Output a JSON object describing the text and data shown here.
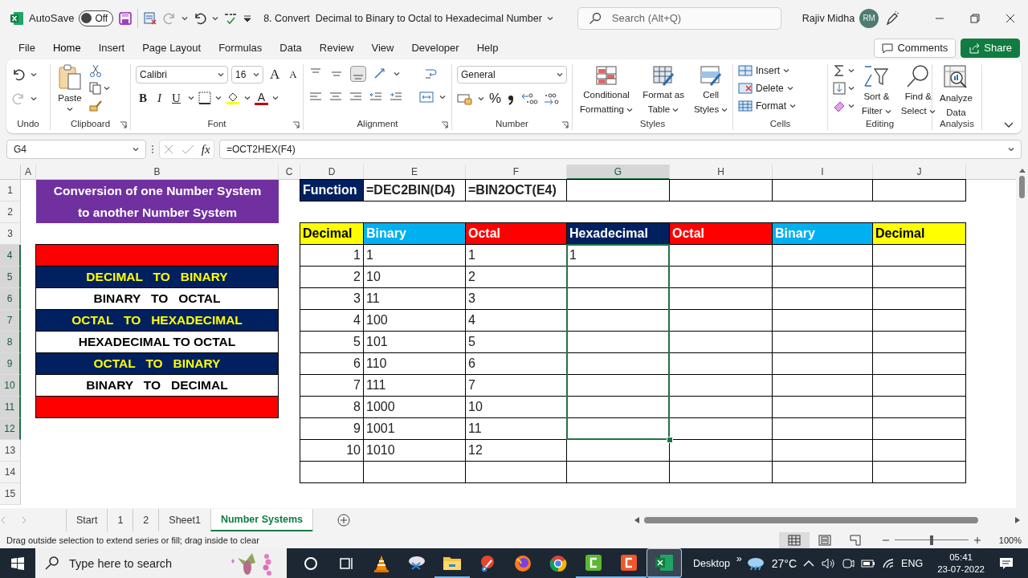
{
  "title_bar": {
    "autosave_label": "AutoSave",
    "autosave": {
      "label": "Off",
      "on": false
    },
    "title": "8. Convert  Decimal to Binary to Octal to Hexadecimal Number",
    "search": {
      "placeholder": "Search (Alt+Q)"
    },
    "user": "Rajiv Midha",
    "avatar": "RM"
  },
  "menu": {
    "tabs": [
      {
        "label": "File",
        "selected": false
      },
      {
        "label": "Home",
        "selected": true
      },
      {
        "label": "Insert",
        "selected": false
      },
      {
        "label": "Page Layout",
        "selected": false
      },
      {
        "label": "Formulas",
        "selected": false
      },
      {
        "label": "Data",
        "selected": false
      },
      {
        "label": "Review",
        "selected": false
      },
      {
        "label": "View",
        "selected": false
      },
      {
        "label": "Developer",
        "selected": false
      },
      {
        "label": "Help",
        "selected": false
      }
    ],
    "buttons": [
      {
        "label": "Comments",
        "kind": "outline"
      },
      {
        "label": "Share",
        "kind": "primary"
      }
    ]
  },
  "ribbon": {
    "groups": [
      {
        "kind": "undo",
        "label": "Undo"
      },
      {
        "kind": "clipboard",
        "label": "Clipboard",
        "paste": "Paste"
      },
      {
        "kind": "font",
        "label": "Font",
        "font": "Calibri",
        "size": "16",
        "size_buttons": [
          "A",
          "A"
        ],
        "style_buttons": [
          "B",
          "I",
          "U"
        ],
        "font_color": "A"
      },
      {
        "kind": "alignment",
        "label": "Alignment"
      },
      {
        "kind": "number",
        "label": "Number",
        "format": "General",
        "percent": "%"
      },
      {
        "kind": "styles",
        "label": "Styles",
        "buttons": [
          {
            "lines": [
              "Conditional",
              "Formatting"
            ]
          },
          {
            "lines": [
              "Format as",
              "Table"
            ]
          },
          {
            "lines": [
              "Cell",
              "Styles"
            ]
          }
        ]
      },
      {
        "kind": "cells",
        "label": "Cells",
        "buttons": [
          "Insert",
          "Delete",
          "Format"
        ]
      },
      {
        "kind": "editing",
        "label": "Editing",
        "buttons": [
          {
            "lines": [
              "Sort &",
              "Filter"
            ]
          },
          {
            "lines": [
              "Find &",
              "Select"
            ]
          }
        ]
      },
      {
        "kind": "analysis",
        "label": "Analysis",
        "buttons": [
          {
            "lines": [
              "Analyze",
              "Data"
            ]
          }
        ]
      }
    ]
  },
  "formula_bar": {
    "name_box": "G4",
    "function_label": "fx",
    "formula": "=OCT2HEX(F4)"
  },
  "grid": {
    "columns": [
      {
        "label": "A",
        "selected": false
      },
      {
        "label": "B",
        "selected": false
      },
      {
        "label": "C",
        "selected": false
      },
      {
        "label": "D",
        "selected": false
      },
      {
        "label": "E",
        "selected": false
      },
      {
        "label": "F",
        "selected": false
      },
      {
        "label": "G",
        "selected": true
      },
      {
        "label": "H",
        "selected": false
      },
      {
        "label": "I",
        "selected": false
      },
      {
        "label": "J",
        "selected": false
      }
    ],
    "rows": [
      {
        "number": "1",
        "selected": false,
        "cells": [
          {
            "kind": "empty"
          },
          {
            "kind": "title",
            "text": "Conversion of one Number System"
          },
          {
            "kind": "empty"
          },
          {
            "kind": "label",
            "text": "Function"
          },
          {
            "kind": "formula",
            "text": "=DEC2BIN(D4)"
          },
          {
            "kind": "formula",
            "text": "=BIN2OCT(E4)"
          },
          {
            "kind": "blank"
          },
          {
            "kind": "blank"
          },
          {
            "kind": "blank"
          },
          {
            "kind": "blank"
          }
        ]
      },
      {
        "number": "2",
        "selected": false,
        "cells": [
          {
            "kind": "empty"
          },
          {
            "kind": "title",
            "text": "to another Number System"
          },
          {
            "kind": "empty"
          },
          {
            "kind": "empty"
          },
          {
            "kind": "empty"
          },
          {
            "kind": "empty"
          },
          {
            "kind": "empty"
          },
          {
            "kind": "empty"
          },
          {
            "kind": "empty"
          },
          {
            "kind": "empty"
          }
        ]
      },
      {
        "number": "3",
        "selected": false,
        "cells": [
          {
            "kind": "empty"
          },
          {
            "kind": "empty"
          },
          {
            "kind": "empty"
          },
          {
            "kind": "header",
            "text": "Decimal",
            "color": "#ffff00"
          },
          {
            "kind": "header",
            "text": "Binary",
            "color": "#00b0f0"
          },
          {
            "kind": "header",
            "text": "Octal",
            "color": "#ff0000"
          },
          {
            "kind": "header",
            "text": "Hexadecimal",
            "color": "#002060"
          },
          {
            "kind": "header",
            "text": "Octal",
            "color": "#ff0000"
          },
          {
            "kind": "header",
            "text": "Binary",
            "color": "#00b0f0"
          },
          {
            "kind": "header",
            "text": "Decimal",
            "color": "#ffff00"
          }
        ]
      },
      {
        "number": "4",
        "selected": true,
        "cells": [
          {
            "kind": "empty"
          },
          {
            "kind": "bar"
          },
          {
            "kind": "empty"
          },
          {
            "kind": "number",
            "text": "1"
          },
          {
            "kind": "value",
            "text": "1"
          },
          {
            "kind": "value",
            "text": "1"
          },
          {
            "kind": "value",
            "text": "1"
          },
          {
            "kind": "box"
          },
          {
            "kind": "box"
          },
          {
            "kind": "box"
          }
        ]
      },
      {
        "number": "5",
        "selected": true,
        "cells": [
          {
            "kind": "empty"
          },
          {
            "kind": "menu_dark",
            "text": "DECIMAL   TO   BINARY"
          },
          {
            "kind": "empty"
          },
          {
            "kind": "number",
            "text": "2"
          },
          {
            "kind": "value",
            "text": "10"
          },
          {
            "kind": "value",
            "text": "2"
          },
          {
            "kind": "box"
          },
          {
            "kind": "box"
          },
          {
            "kind": "box"
          },
          {
            "kind": "box"
          }
        ]
      },
      {
        "number": "6",
        "selected": true,
        "cells": [
          {
            "kind": "empty"
          },
          {
            "kind": "menu_light",
            "text": "BINARY   TO   OCTAL"
          },
          {
            "kind": "empty"
          },
          {
            "kind": "number",
            "text": "3"
          },
          {
            "kind": "value",
            "text": "11"
          },
          {
            "kind": "value",
            "text": "3"
          },
          {
            "kind": "box"
          },
          {
            "kind": "box"
          },
          {
            "kind": "box"
          },
          {
            "kind": "box"
          }
        ]
      },
      {
        "number": "7",
        "selected": true,
        "cells": [
          {
            "kind": "empty"
          },
          {
            "kind": "menu_dark",
            "text": "OCTAL   TO   HEXADECIMAL"
          },
          {
            "kind": "empty"
          },
          {
            "kind": "number",
            "text": "4"
          },
          {
            "kind": "value",
            "text": "100"
          },
          {
            "kind": "value",
            "text": "4"
          },
          {
            "kind": "box"
          },
          {
            "kind": "box"
          },
          {
            "kind": "box"
          },
          {
            "kind": "box"
          }
        ]
      },
      {
        "number": "8",
        "selected": true,
        "cells": [
          {
            "kind": "empty"
          },
          {
            "kind": "menu_light",
            "text": "HEXADECIMAL TO OCTAL"
          },
          {
            "kind": "empty"
          },
          {
            "kind": "number",
            "text": "5"
          },
          {
            "kind": "value",
            "text": "101"
          },
          {
            "kind": "value",
            "text": "5"
          },
          {
            "kind": "box"
          },
          {
            "kind": "box"
          },
          {
            "kind": "box"
          },
          {
            "kind": "box"
          }
        ]
      },
      {
        "number": "9",
        "selected": true,
        "cells": [
          {
            "kind": "empty"
          },
          {
            "kind": "menu_dark",
            "text": "OCTAL   TO   BINARY"
          },
          {
            "kind": "empty"
          },
          {
            "kind": "number",
            "text": "6"
          },
          {
            "kind": "value",
            "text": "110"
          },
          {
            "kind": "value",
            "text": "6"
          },
          {
            "kind": "box"
          },
          {
            "kind": "box"
          },
          {
            "kind": "box"
          },
          {
            "kind": "box"
          }
        ]
      },
      {
        "number": "10",
        "selected": true,
        "cells": [
          {
            "kind": "empty"
          },
          {
            "kind": "menu_light",
            "text": "BINARY   TO   DECIMAL"
          },
          {
            "kind": "empty"
          },
          {
            "kind": "number",
            "text": "7"
          },
          {
            "kind": "value",
            "text": "111"
          },
          {
            "kind": "value",
            "text": "7"
          },
          {
            "kind": "box"
          },
          {
            "kind": "box"
          },
          {
            "kind": "box"
          },
          {
            "kind": "box"
          }
        ]
      },
      {
        "number": "11",
        "selected": true,
        "cells": [
          {
            "kind": "empty"
          },
          {
            "kind": "bar"
          },
          {
            "kind": "empty"
          },
          {
            "kind": "number",
            "text": "8"
          },
          {
            "kind": "value",
            "text": "1000"
          },
          {
            "kind": "value",
            "text": "10"
          },
          {
            "kind": "box"
          },
          {
            "kind": "box"
          },
          {
            "kind": "box"
          },
          {
            "kind": "box"
          }
        ]
      },
      {
        "number": "12",
        "selected": true,
        "cells": [
          {
            "kind": "empty"
          },
          {
            "kind": "empty"
          },
          {
            "kind": "empty"
          },
          {
            "kind": "number",
            "text": "9"
          },
          {
            "kind": "value",
            "text": "1001"
          },
          {
            "kind": "value",
            "text": "11"
          },
          {
            "kind": "box"
          },
          {
            "kind": "box"
          },
          {
            "kind": "box"
          },
          {
            "kind": "box"
          }
        ]
      },
      {
        "number": "13",
        "selected": false,
        "cells": [
          {
            "kind": "empty"
          },
          {
            "kind": "empty"
          },
          {
            "kind": "empty"
          },
          {
            "kind": "number",
            "text": "10"
          },
          {
            "kind": "value",
            "text": "1010"
          },
          {
            "kind": "value",
            "text": "12"
          },
          {
            "kind": "box"
          },
          {
            "kind": "box"
          },
          {
            "kind": "box"
          },
          {
            "kind": "box"
          }
        ]
      },
      {
        "number": "14",
        "selected": false,
        "cells": [
          {
            "kind": "empty"
          },
          {
            "kind": "empty"
          },
          {
            "kind": "empty"
          },
          {
            "kind": "blank"
          },
          {
            "kind": "box"
          },
          {
            "kind": "box"
          },
          {
            "kind": "box"
          },
          {
            "kind": "box"
          },
          {
            "kind": "box"
          },
          {
            "kind": "blank"
          }
        ]
      },
      {
        "number": "15",
        "selected": false,
        "cells": [
          {
            "kind": "empty"
          },
          {
            "kind": "empty"
          },
          {
            "kind": "empty"
          },
          {
            "kind": "empty"
          },
          {
            "kind": "empty"
          },
          {
            "kind": "empty"
          },
          {
            "kind": "empty"
          },
          {
            "kind": "empty"
          },
          {
            "kind": "empty"
          },
          {
            "kind": "empty"
          }
        ]
      }
    ]
  },
  "sheet_tabs": {
    "tabs": [
      {
        "label": "Start",
        "selected": false
      },
      {
        "label": "1",
        "selected": false
      },
      {
        "label": "2",
        "selected": false
      },
      {
        "label": "Sheet1",
        "selected": false
      },
      {
        "label": "Number Systems",
        "selected": true
      }
    ]
  },
  "status_bar": {
    "message": "Drag outside selection to extend series or fill; drag inside to clear",
    "views": [
      {
        "kind": "normal",
        "selected": true
      },
      {
        "kind": "page_layout",
        "selected": false
      },
      {
        "kind": "page_break",
        "selected": false
      }
    ],
    "zoom": {
      "level": 0.5
    },
    "zoom_label": "100%"
  },
  "taskbar": {
    "search": {
      "placeholder": "Type here to search"
    },
    "apps": [
      {
        "kind": "circle",
        "running": false,
        "selected": false
      },
      {
        "kind": "task_view",
        "running": false,
        "selected": false
      },
      {
        "kind": "cone",
        "running": false,
        "selected": false
      },
      {
        "kind": "snip",
        "running": false,
        "selected": false
      },
      {
        "kind": "folder",
        "running": true,
        "selected": false
      },
      {
        "kind": "brush",
        "running": false,
        "selected": false
      },
      {
        "kind": "fox",
        "running": false,
        "selected": false
      },
      {
        "kind": "chrome",
        "running": false,
        "selected": false
      },
      {
        "kind": "rec_green",
        "running": true,
        "selected": false
      },
      {
        "kind": "rec_orange",
        "running": true,
        "selected": false
      },
      {
        "kind": "sheet",
        "running": true,
        "selected": true
      }
    ],
    "desktop": "Desktop",
    "more": "»",
    "weather": "27°C",
    "language": "ENG",
    "time": "05:41",
    "date": "23-07-2022"
  }
}
